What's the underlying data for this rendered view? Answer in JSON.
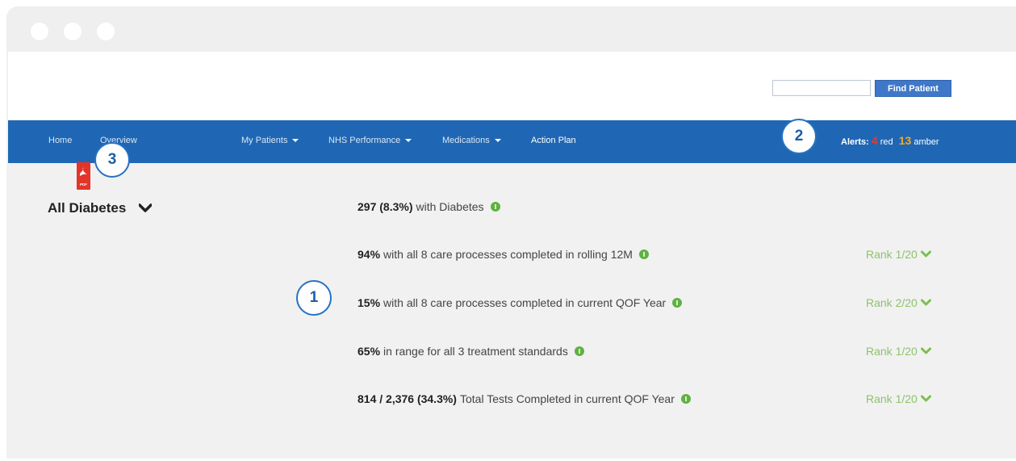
{
  "header": {
    "find_patient_label": "Find Patient",
    "search_placeholder": ""
  },
  "nav": {
    "home": "Home",
    "overview": "Overview",
    "my_patients": "My Patients",
    "nhs_performance": "NHS Performance",
    "medications": "Medications",
    "action_plan": "Action Plan"
  },
  "alerts": {
    "label": "Alerts:",
    "red_count": "4",
    "red_label": "red",
    "amber_count": "13",
    "amber_label": "amber"
  },
  "badges": {
    "b1": "1",
    "b2": "2",
    "b3": "3"
  },
  "pdf": {
    "label": "PDF"
  },
  "section": {
    "title": "All Diabetes"
  },
  "metrics": [
    {
      "strong": "297 (8.3%)",
      "text": "with Diabetes",
      "rank": ""
    },
    {
      "strong": "94%",
      "text": "with all 8 care processes completed in rolling 12M",
      "rank": "Rank 1/20"
    },
    {
      "strong": "15%",
      "text": "with all 8 care processes completed in current QOF Year",
      "rank": "Rank 2/20"
    },
    {
      "strong": "65%",
      "text": "in range for all 3 treatment standards",
      "rank": "Rank 1/20"
    },
    {
      "strong": "814 / 2,376 (34.3%)",
      "text": "Total Tests Completed in current QOF Year",
      "rank": "Rank 1/20"
    }
  ],
  "colors": {
    "nav_bg": "#1f67b4",
    "badge_blue": "#2672c2",
    "rank_green": "#8cc36c",
    "info_green": "#5fb143",
    "alert_red": "#e53935",
    "alert_amber": "#f0a830"
  }
}
